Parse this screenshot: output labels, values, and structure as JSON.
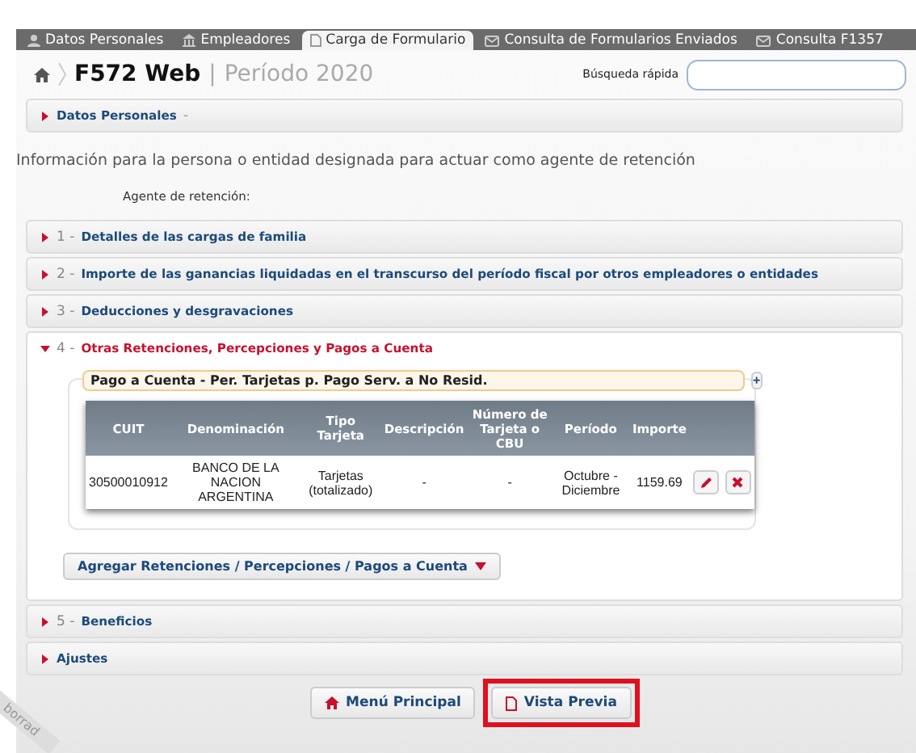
{
  "tabs": [
    {
      "label": "Datos Personales",
      "kind": "person",
      "selected": false
    },
    {
      "label": "Empleadores",
      "kind": "building",
      "selected": false
    },
    {
      "label": "Carga de Formulario",
      "kind": "page",
      "selected": true
    },
    {
      "label": "Consulta de Formularios Enviados",
      "kind": "mail",
      "selected": false
    },
    {
      "label": "Consulta F1357",
      "kind": "mail",
      "selected": false
    }
  ],
  "header": {
    "title": "F572 Web",
    "separator": "|",
    "period": "Período 2020",
    "search_label": "Búsqueda rápida"
  },
  "personal": {
    "title": "Datos Personales",
    "suffix": "-"
  },
  "info_text": "Información para la persona o entidad designada para actuar como agente de retención",
  "agent_label": "Agente de retención:",
  "sections": [
    {
      "number": "1 -",
      "title": "Detalles de las cargas de familia",
      "expanded": false
    },
    {
      "number": "2 -",
      "title": "Importe de las ganancias liquidadas en el transcurso del período fiscal por otros empleadores o entidades",
      "expanded": false
    },
    {
      "number": "3 -",
      "title": "Deducciones y desgravaciones",
      "expanded": false
    },
    {
      "number": "4 -",
      "title": "Otras Retenciones, Percepciones y Pagos a Cuenta",
      "expanded": true,
      "group": {
        "title": "Pago a Cuenta - Per. Tarjetas p. Pago Serv. a No Resid.",
        "add": "+",
        "columns": [
          "CUIT",
          "Denominación",
          "Tipo Tarjeta",
          "Descripción",
          "Número de Tarjeta o CBU",
          "Período",
          "Importe"
        ],
        "rows": [
          [
            "30500010912",
            "BANCO DE LA NACION ARGENTINA",
            "Tarjetas (totalizado)",
            "-",
            "-",
            "Octubre - Diciembre",
            "1159.69"
          ]
        ]
      },
      "add_button": "Agregar Retenciones / Percepciones / Pagos a Cuenta"
    },
    {
      "number": "5 -",
      "title": "Beneficios",
      "expanded": false
    },
    {
      "title": "Ajustes",
      "expanded": false
    }
  ],
  "ribbon": "borrad",
  "footer_buttons": [
    {
      "label": "Menú Principal",
      "kind": "home",
      "highlighted": false
    },
    {
      "label": "Vista Previa",
      "kind": "document",
      "highlighted": true
    }
  ]
}
